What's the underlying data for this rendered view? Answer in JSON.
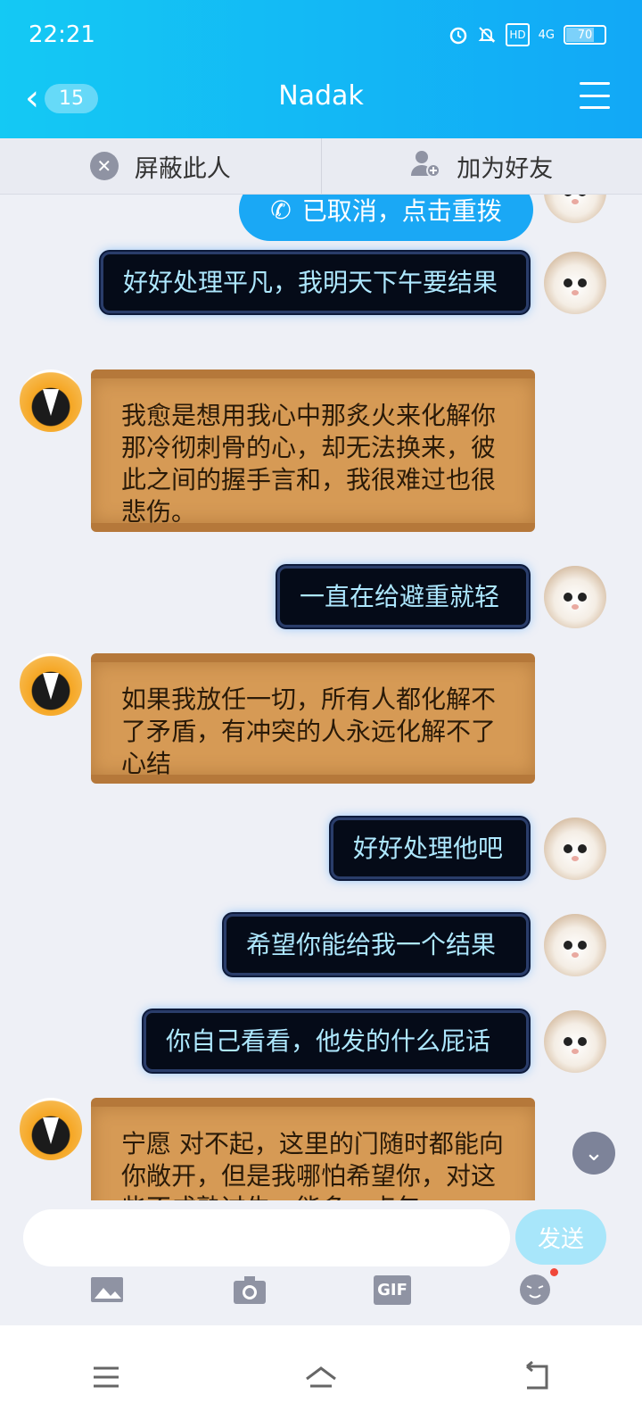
{
  "status_bar": {
    "time": "22:21",
    "battery": "70",
    "network": "4G",
    "hd": "HD"
  },
  "header": {
    "back_count": "15",
    "title": "Nadak"
  },
  "action_bar": {
    "block_label": "屏蔽此人",
    "add_friend_label": "加为好友"
  },
  "messages": [
    {
      "side": "right",
      "style": "call",
      "text": "已取消，点击重拨"
    },
    {
      "side": "right",
      "style": "dark",
      "text": "好好处理平凡，我明天下午要结果"
    },
    {
      "side": "left",
      "style": "scroll",
      "text": "我愈是想用我心中那炙火来化解你那冷彻刺骨的心，却无法换来，彼此之间的握手言和，我很难过也很悲伤。"
    },
    {
      "side": "right",
      "style": "dark",
      "text": "一直在给避重就轻"
    },
    {
      "side": "left",
      "style": "scroll",
      "text": "如果我放任一切，所有人都化解不了矛盾，有冲突的人永远化解不了心结"
    },
    {
      "side": "right",
      "style": "dark",
      "text": "好好处理他吧"
    },
    {
      "side": "right",
      "style": "dark",
      "text": "希望你能给我一个结果"
    },
    {
      "side": "right",
      "style": "dark",
      "text": "你自己看看，他发的什么屁话"
    },
    {
      "side": "left",
      "style": "scroll",
      "text": "宁愿  对不起，这里的门随时都能向你敞开，但是我哪怕希望你，对这些不成熟过失，能多一点包"
    }
  ],
  "input": {
    "placeholder": "",
    "send_label": "发送"
  },
  "toolbar": {
    "icons": [
      "image-icon",
      "camera-icon",
      "gif-icon",
      "emoji-icon"
    ],
    "gif_label": "GIF"
  },
  "colors": {
    "header_start": "#14c9f4",
    "header_end": "#12a8f6",
    "send_disabled": "#a8e6fa"
  }
}
